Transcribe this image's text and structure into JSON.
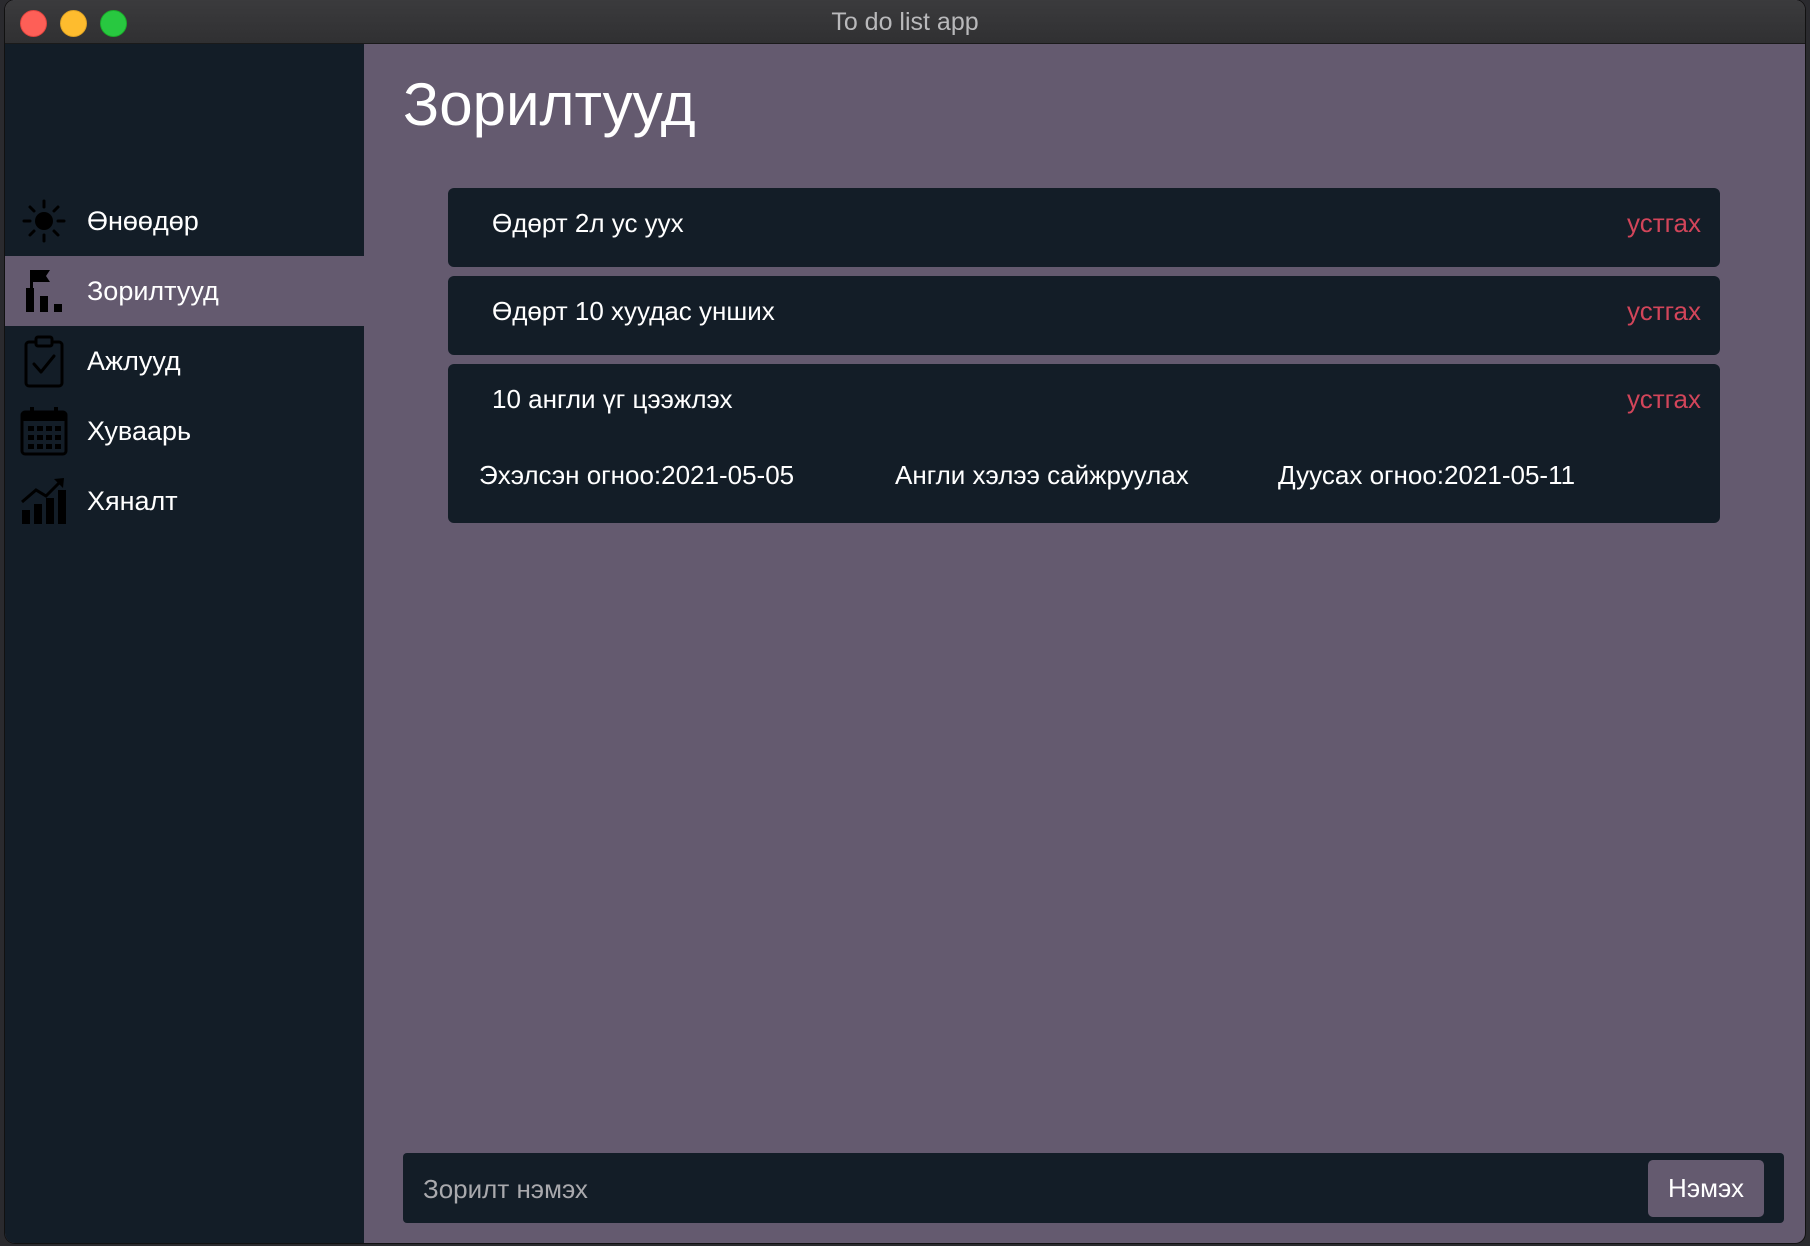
{
  "window": {
    "title": "To do list app"
  },
  "sidebar": {
    "items": [
      {
        "label": "Өнөөдөр",
        "icon": "sun-icon",
        "active": false
      },
      {
        "label": "Зорилтууд",
        "icon": "goal-flag-icon",
        "active": true
      },
      {
        "label": "Ажлууд",
        "icon": "clipboard-check-icon",
        "active": false
      },
      {
        "label": "Хуваарь",
        "icon": "calendar-icon",
        "active": false
      },
      {
        "label": "Хяналт",
        "icon": "growth-chart-icon",
        "active": false
      }
    ]
  },
  "main": {
    "title": "Зорилтууд",
    "goals": [
      {
        "title": "Өдөрт 2л ус уух",
        "delete_label": "устгах"
      },
      {
        "title": "Өдөрт 10 хуудас унших",
        "delete_label": "устгах"
      },
      {
        "title": "10 англи үг цээжлэх",
        "delete_label": "устгах",
        "start_date": "Эхэлсэн огноо:2021-05-05",
        "description": "Англи хэлээ сайжруулах",
        "end_date": "Дуусах огноо:2021-05-11"
      }
    ],
    "add": {
      "placeholder": "Зорилт нэмэх",
      "button_label": "Нэмэх"
    }
  },
  "colors": {
    "sidebar_bg": "#131d27",
    "main_bg": "#645a6f",
    "card_bg": "#131d27",
    "delete_text": "#d2455a",
    "text": "#ffffff"
  }
}
